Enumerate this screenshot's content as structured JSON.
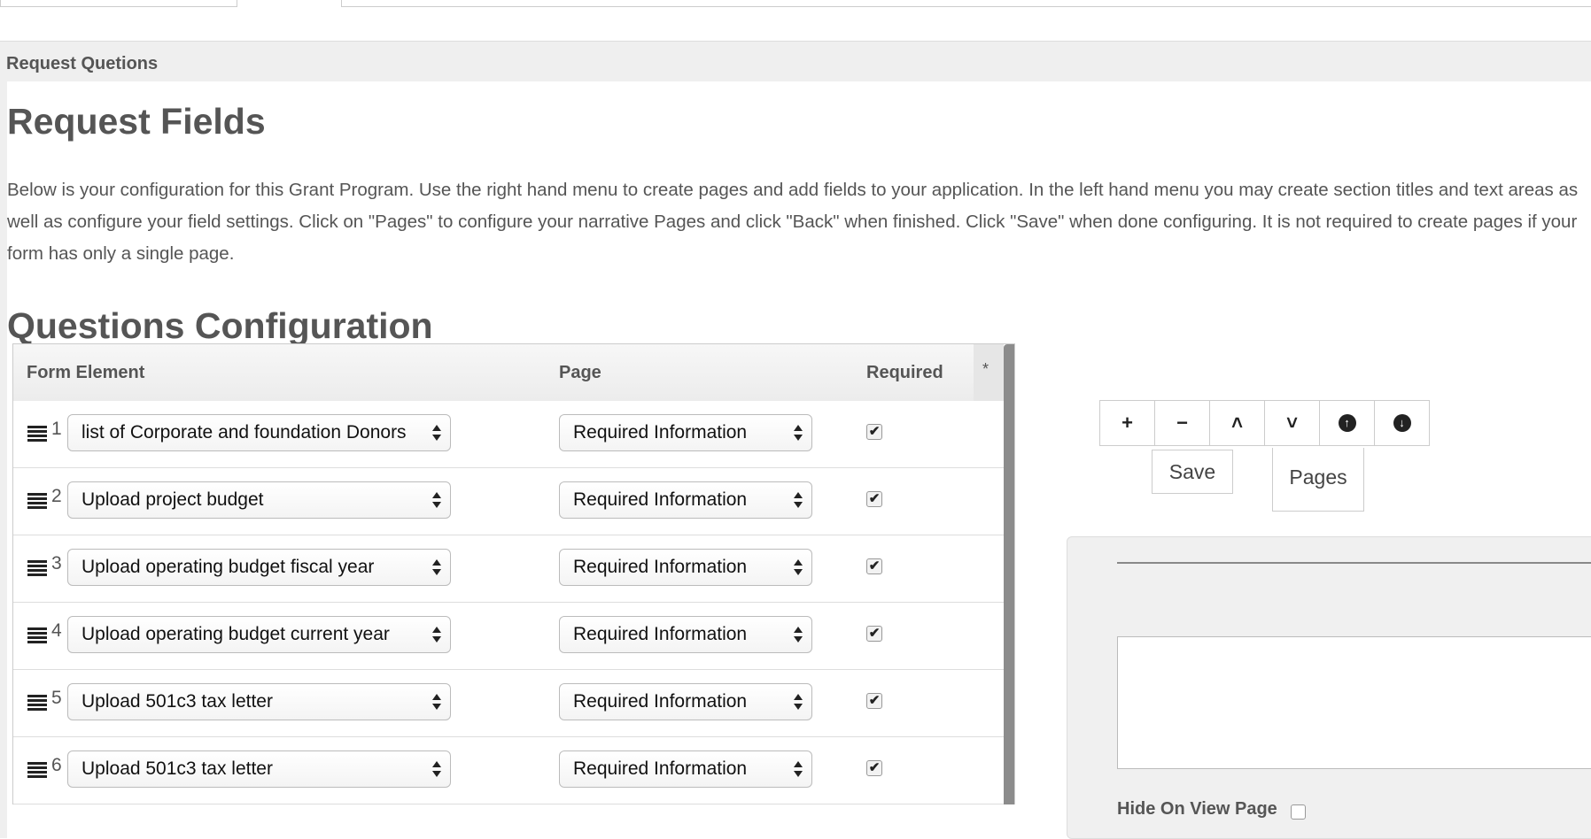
{
  "panel": {
    "heading": "Request Quetions"
  },
  "content": {
    "title": "Request Fields",
    "description": "Below is your configuration for this Grant Program. Use the right hand menu to create pages and add fields to your application. In the left hand menu you may create section titles and text areas as well as configure your field settings. Click on \"Pages\" to configure your narrative Pages and click \"Back\" when finished. Click \"Save\" when done configuring. It is not required to create pages if your form has only a single page.",
    "questions_title": "Questions Configuration"
  },
  "table": {
    "headers": {
      "form_element": "Form Element",
      "page": "Page",
      "required": "Required",
      "star": "*"
    },
    "rows": [
      {
        "num": "1",
        "element": "list of Corporate and foundation Donors",
        "page": "Required Information",
        "required": true
      },
      {
        "num": "2",
        "element": "Upload project budget",
        "page": "Required Information",
        "required": true
      },
      {
        "num": "3",
        "element": "Upload operating budget fiscal year",
        "page": "Required Information",
        "required": true
      },
      {
        "num": "4",
        "element": "Upload operating budget current year",
        "page": "Required Information",
        "required": true
      },
      {
        "num": "5",
        "element": "Upload 501c3 tax letter",
        "page": "Required Information",
        "required": true
      },
      {
        "num": "6",
        "element": "Upload 501c3 tax letter",
        "page": "Required Information",
        "required": true
      }
    ]
  },
  "toolbar": {
    "buttons": [
      {
        "name": "add",
        "glyph": "+"
      },
      {
        "name": "remove",
        "glyph": "−"
      },
      {
        "name": "move-up",
        "glyph": "˄"
      },
      {
        "name": "move-down",
        "glyph": "˅"
      },
      {
        "name": "move-top",
        "glyph": "↑"
      },
      {
        "name": "move-bottom",
        "glyph": "↓"
      }
    ],
    "save_label": "Save",
    "pages_label": "Pages"
  },
  "config": {
    "hide_label": "Hide On View Page",
    "hide_checked": false
  },
  "colors": {
    "panel_bg": "#efefef",
    "text": "#555555",
    "scrollbar": "#8c8c8c"
  }
}
